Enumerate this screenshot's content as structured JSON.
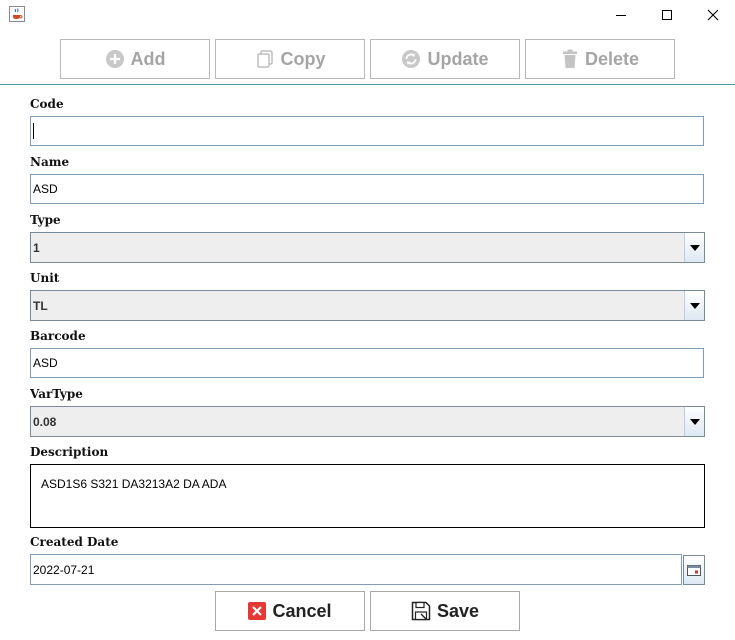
{
  "titlebar": {
    "app_icon": "java-cup-icon",
    "minimize_icon": "minimize-icon",
    "maximize_icon": "maximize-icon",
    "close_icon": "close-icon"
  },
  "toolbar": {
    "add_label": "Add",
    "copy_label": "Copy",
    "update_label": "Update",
    "delete_label": "Delete",
    "disabled_color": "#a5a5a5"
  },
  "form": {
    "code_label": "Code",
    "code_value": "",
    "name_label": "Name",
    "name_value": "ASD",
    "type_label": "Type",
    "type_value": "1",
    "unit_label": "Unit",
    "unit_value": "TL",
    "barcode_label": "Barcode",
    "barcode_value": "ASD",
    "vartype_label": "VarType",
    "vartype_value": "0.08",
    "description_label": "Description",
    "description_value": "ASD1S6 S321 DA3213A2 DA ADA",
    "created_date_label": "Created Date",
    "created_date_value": "2022-07-21"
  },
  "actions": {
    "cancel_label": "Cancel",
    "save_label": "Save",
    "cancel_icon_color": "#e53935"
  },
  "accent": "#4d9ba0"
}
